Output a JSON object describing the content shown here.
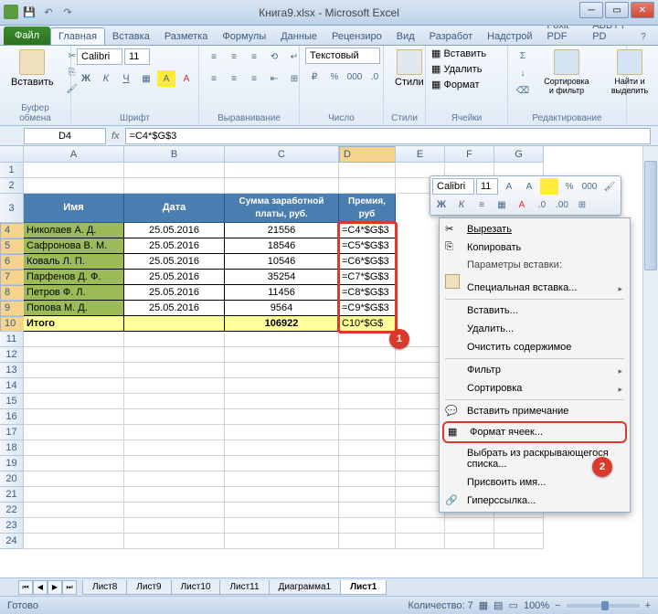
{
  "window": {
    "title": "Книга9.xlsx - Microsoft Excel"
  },
  "tabs": {
    "file": "Файл",
    "items": [
      "Главная",
      "Вставка",
      "Разметка",
      "Формулы",
      "Данные",
      "Рецензиро",
      "Вид",
      "Разработ",
      "Надстрой",
      "Foxit PDF",
      "ABBYY PD"
    ]
  },
  "ribbon": {
    "groups": [
      "Буфер обмена",
      "Шрифт",
      "Выравнивание",
      "Число",
      "Стили",
      "Ячейки",
      "Редактирование"
    ],
    "paste": "Вставить",
    "font": "Calibri",
    "size": "11",
    "numfmt": "Текстовый",
    "styles": "Стили",
    "insert": "Вставить",
    "delete": "Удалить",
    "format": "Формат",
    "sort": "Сортировка и фильтр",
    "find": "Найти и выделить"
  },
  "nb": {
    "cell": "D4",
    "formula": "=C4*$G$3"
  },
  "cols": [
    "A",
    "B",
    "C",
    "D",
    "E",
    "F",
    "G"
  ],
  "cw": [
    110,
    110,
    125,
    62,
    54,
    54,
    54
  ],
  "rows": [
    1,
    2,
    3,
    4,
    5,
    6,
    7,
    8,
    9,
    10,
    11,
    12,
    13,
    14,
    15,
    16,
    17,
    18,
    19,
    20,
    21,
    22,
    23,
    24
  ],
  "hdr": {
    "name": "Имя",
    "date": "Дата",
    "sum": "Сумма заработной платы, руб.",
    "bonus": "Премия, руб"
  },
  "data": [
    {
      "n": "Николаев А. Д.",
      "d": "25.05.2016",
      "s": "21556",
      "f": "=C4*$G$3"
    },
    {
      "n": "Сафронова В. М.",
      "d": "25.05.2016",
      "s": "18546",
      "f": "=C5*$G$3"
    },
    {
      "n": "Коваль Л. П.",
      "d": "25.05.2016",
      "s": "10546",
      "f": "=C6*$G$3"
    },
    {
      "n": "Парфенов Д. Ф.",
      "d": "25.05.2016",
      "s": "35254",
      "f": "=C7*$G$3"
    },
    {
      "n": "Петров Ф. Л.",
      "d": "25.05.2016",
      "s": "11456",
      "f": "=C8*$G$3"
    },
    {
      "n": "Попова М. Д.",
      "d": "25.05.2016",
      "s": "9564",
      "f": "=C9*$G$3"
    }
  ],
  "total": {
    "label": "Итого",
    "sum": "106922",
    "f": "C10*$G$"
  },
  "mini": {
    "font": "Calibri",
    "size": "11"
  },
  "ctx": {
    "cut": "Вырезать",
    "copy": "Копировать",
    "pasteopts": "Параметры вставки:",
    "pastespecial": "Специальная вставка...",
    "ins": "Вставить...",
    "del": "Удалить...",
    "clear": "Очистить содержимое",
    "filter": "Фильтр",
    "sort": "Сортировка",
    "comment": "Вставить примечание",
    "format": "Формат ячеек...",
    "dropdown": "Выбрать из раскрывающегося списка...",
    "name": "Присвоить имя...",
    "link": "Гиперссылка..."
  },
  "sheets": [
    "Лист8",
    "Лист9",
    "Лист10",
    "Лист11",
    "Диаграмма1",
    "Лист1"
  ],
  "status": {
    "ready": "Готово",
    "count": "Количество: 7",
    "zoom": "100%"
  },
  "badges": {
    "b1": "1",
    "b2": "2"
  }
}
